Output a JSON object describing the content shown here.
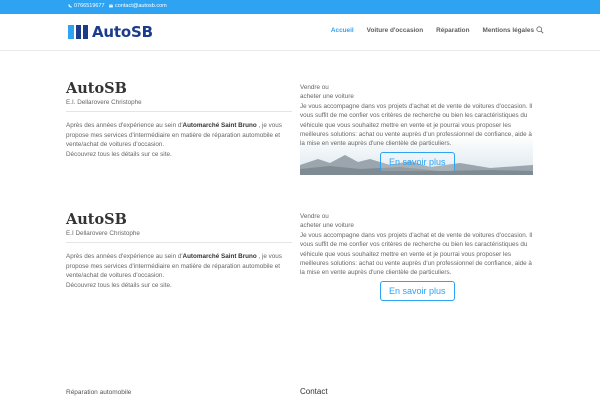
{
  "topbar": {
    "phone": "0766519677",
    "email": "contact@autosb.com",
    "phone_icon": "phone-icon",
    "email_icon": "envelope-icon"
  },
  "header": {
    "logo_text": "AutoSB",
    "nav": [
      {
        "label": "Accueil",
        "active": true
      },
      {
        "label": "Voiture d'occasion",
        "active": false
      },
      {
        "label": "Réparation",
        "active": false
      },
      {
        "label": "Mentions légales",
        "active": false
      }
    ],
    "search_icon": "search-icon",
    "accent": "#2ea3f2",
    "brand": "#1b3c8c"
  },
  "section1": {
    "title": "AutoSB",
    "subtitle": "E.I. Dellarovere Christophe",
    "para_1": "Après des années d'expérience au sein d'",
    "para_bold": "Automarché Saint Bruno",
    "para_2": " , je vous propose mes services d'intermédiaire en matière de réparation automobile et vente/achat de voitures d'occasion.",
    "para_3": "Découvrez tous les détails sur ce site.",
    "right_line1": "Vendre ou",
    "right_line2": "acheter une voiture",
    "right_text": "Je vous accompagne dans vos projets d'achat et de vente de voitures d'occasion. Il vous suffit de me confier vos critères de recherche ou bien les caractéristiques du véhicule que vous souhaitez mettre en vente et je pourrai vous proposer les meilleures solutions: achat ou vente auprès d'un professionnel de confiance, aide à la mise en vente auprès d'une clientèle de particuliers.",
    "button": "En savoir plus"
  },
  "section2": {
    "title": "AutoSB",
    "subtitle": "E.I Dellarovere Christophe",
    "para_1": "Après des années d'expérience au sein d'",
    "para_bold": "Automarché Saint Bruno",
    "para_2": " , je vous propose mes services d'intermédiaire en matière de réparation automobile et vente/achat de voitures d'occasion.",
    "para_3": "Découvrez tous les détails sur ce site.",
    "right_line1": "Vendre ou",
    "right_line2": "acheter une voiture",
    "right_text": "Je vous accompagne dans vos projets d'achat et de vente de voitures d'occasion. Il vous suffit de me confier vos critères de recherche ou bien les caractéristiques du véhicule que vous souhaitez mettre en vente et je pourrai vous proposer les meilleures solutions: achat ou vente auprès d'un professionnel de confiance, aide à la mise en vente auprès d'une clientèle de particuliers.",
    "button": "En savoir plus"
  },
  "footer": {
    "left": "Réparation automobile",
    "right": "Contact"
  }
}
